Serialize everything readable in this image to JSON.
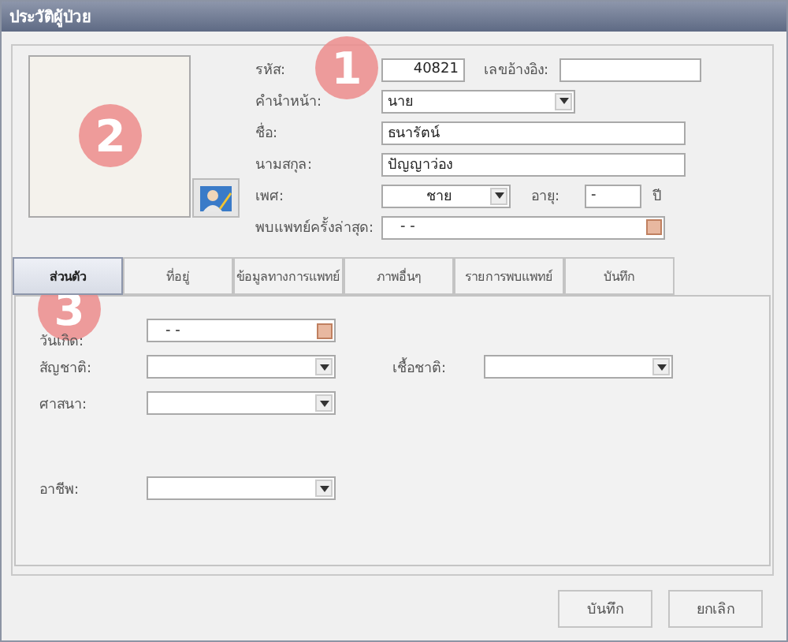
{
  "window": {
    "title": "ประวัติผู้ป่วย"
  },
  "header": {
    "code": {
      "label": "รหัส:",
      "value": "40821"
    },
    "reference": {
      "label": "เลขอ้างอิง:"
    },
    "prefix": {
      "label": "คำนำหน้า:",
      "value": "นาย"
    },
    "first_name": {
      "label": "ชื่อ:",
      "value": "ธนารัตน์"
    },
    "last_name": {
      "label": "นามสกุล:",
      "value": "ปัญญาว่อง"
    },
    "sex": {
      "label": "เพศ:",
      "value": "ชาย"
    },
    "age": {
      "label": "อายุ:",
      "value": "-",
      "unit": "ปี"
    },
    "last_visit": {
      "label": "พบแพทย์ครั้งล่าสุด:",
      "value": "- -"
    }
  },
  "tabs": [
    {
      "label": "ส่วนตัว",
      "selected": true
    },
    {
      "label": "ที่อยู่",
      "selected": false
    },
    {
      "label": "ข้อมูลทางการแพทย์",
      "selected": false
    },
    {
      "label": "ภาพอื่นๆ",
      "selected": false
    },
    {
      "label": "รายการพบแพทย์",
      "selected": false
    },
    {
      "label": "บันทึก",
      "selected": false
    }
  ],
  "personal": {
    "birth_date": {
      "label": "วันเกิด:",
      "value": "- -"
    },
    "nationality": {
      "label": "สัญชาติ:"
    },
    "race": {
      "label": "เชื้อชาติ:"
    },
    "religion": {
      "label": "ศาสนา:"
    },
    "occupation": {
      "label": "อาชีพ:"
    }
  },
  "buttons": [
    {
      "label": "บันทึก"
    },
    {
      "label": "ยกเลิก"
    }
  ],
  "markers": [
    "1",
    "2",
    "3"
  ]
}
